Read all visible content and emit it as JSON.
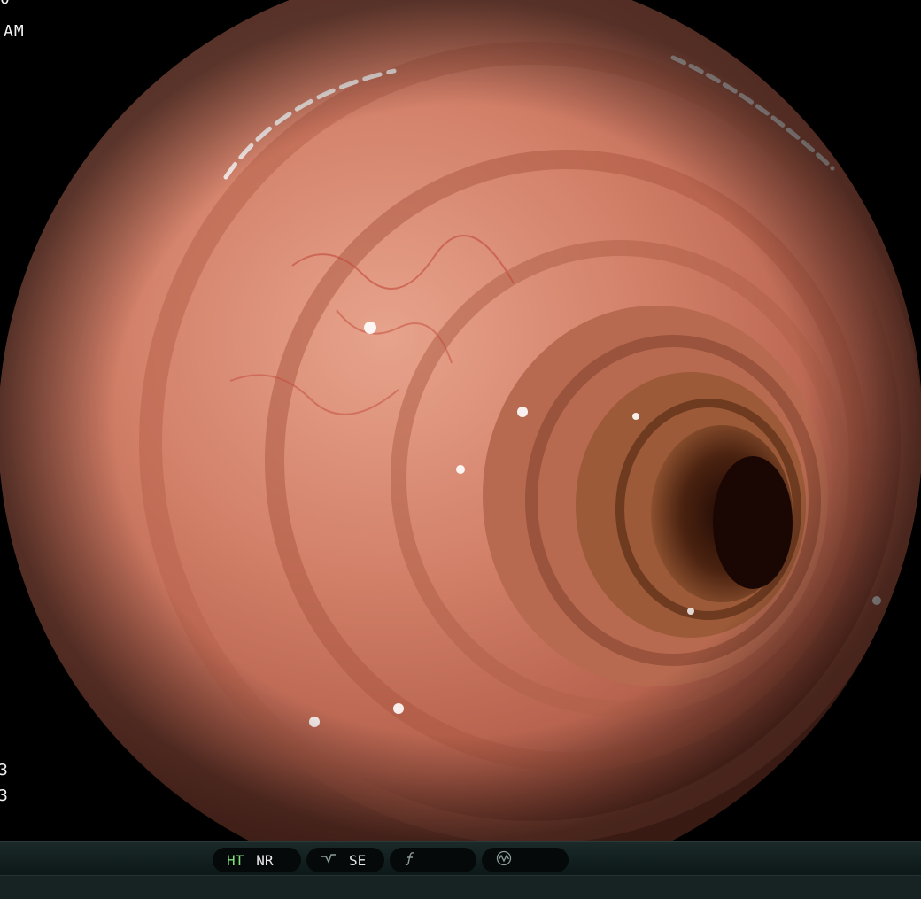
{
  "overlay": {
    "top_partial": "0",
    "top_ampm": "AM",
    "left_a": "3",
    "left_b": "3"
  },
  "statusbar": {
    "pill1": {
      "ht": "HT",
      "nr": "NR"
    },
    "pill2": {
      "icon": "wave-icon",
      "se": "SE"
    },
    "pill3": {
      "icon": "function-icon"
    },
    "pill4": {
      "icon": "signal-icon"
    }
  },
  "colors": {
    "mucosa": "#c46c58",
    "lumen": "#2b0f06",
    "active_label": "#7fe07a"
  }
}
